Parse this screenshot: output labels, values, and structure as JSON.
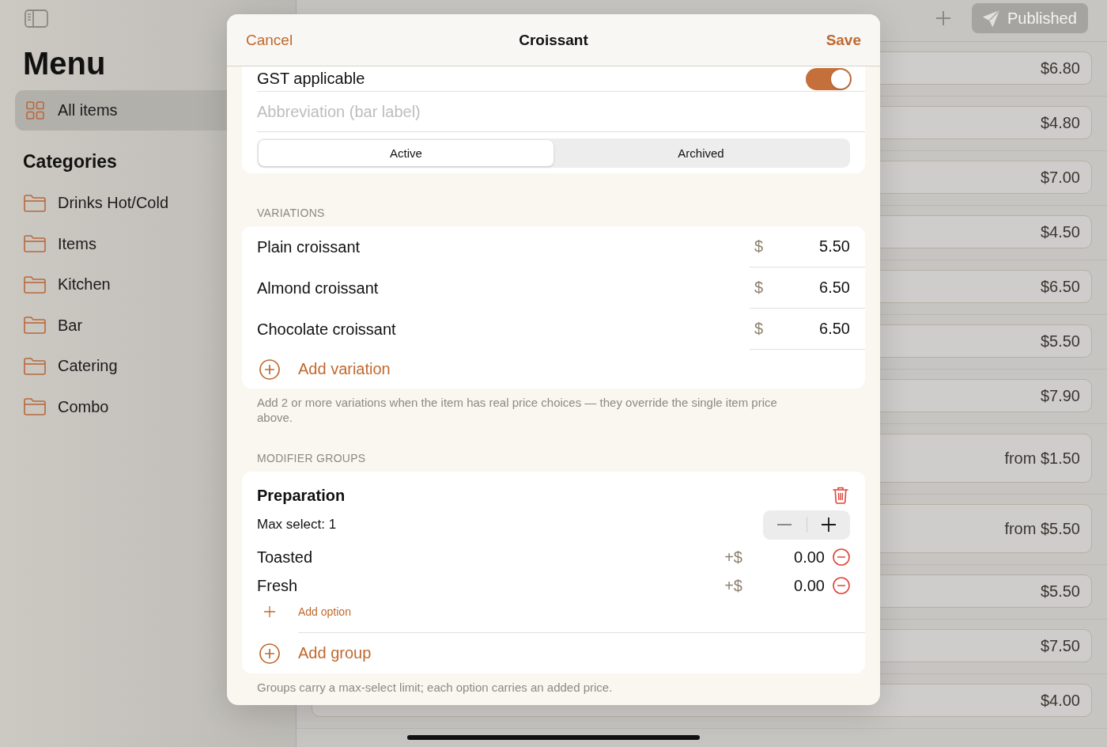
{
  "sidebar": {
    "title": "Menu",
    "items": [
      {
        "label": "All items",
        "selected": true
      }
    ],
    "categories_title": "Categories",
    "categories": [
      {
        "label": "Drinks Hot/Cold",
        "selected": false
      },
      {
        "label": "Items",
        "selected": false
      },
      {
        "label": "Kitchen",
        "selected": false
      },
      {
        "label": "Bar",
        "selected": false
      },
      {
        "label": "Catering",
        "selected": false
      },
      {
        "label": "Combo",
        "selected": false
      }
    ]
  },
  "toolbar": {
    "publish_button": "Published"
  },
  "item_list": {
    "rows": [
      {
        "price": "$6.80",
        "kind": "fixed"
      },
      {
        "price": "$4.80",
        "kind": "fixed"
      },
      {
        "price": "$7.00",
        "kind": "fixed"
      },
      {
        "price": "$4.50",
        "kind": "fixed"
      },
      {
        "price": "$6.50",
        "kind": "fixed"
      },
      {
        "price": "$5.50",
        "kind": "fixed"
      },
      {
        "price": "$7.90",
        "kind": "fixed"
      },
      {
        "price": "from $1.50",
        "kind": "range"
      },
      {
        "price": "from $5.50",
        "kind": "range"
      },
      {
        "price": "$5.50",
        "kind": "fixed"
      },
      {
        "price": "$7.50",
        "kind": "fixed"
      },
      {
        "price": "$4.00",
        "kind": "fixed"
      }
    ]
  },
  "dialog": {
    "cancel": "Cancel",
    "title": "Croissant",
    "save": "Save",
    "gst": {
      "label": "GST applicable",
      "on": true
    },
    "abbreviation": {
      "placeholder": "Abbreviation (bar label)"
    },
    "status_tabs": [
      {
        "label": "Active",
        "selected": true
      },
      {
        "label": "Archived",
        "selected": false
      }
    ],
    "variations": {
      "heading": "VARIATIONS",
      "rows": [
        {
          "name": "Plain croissant",
          "currency": "$",
          "price": "5.50"
        },
        {
          "name": "Almond croissant",
          "currency": "$",
          "price": "6.50"
        },
        {
          "name": "Chocolate croissant",
          "currency": "$",
          "price": "6.50"
        }
      ],
      "add_label": "Add variation",
      "note": "Add 2 or more variations when the item has real price choices — they override the single item price above."
    },
    "modifier_groups": {
      "heading": "MODIFIER GROUPS",
      "groups": [
        {
          "name": "Preparation",
          "max_select": "Max select: 1",
          "options": [
            {
              "name": "Toasted",
              "prefix": "+$",
              "price": "0.00"
            },
            {
              "name": "Fresh",
              "prefix": "+$",
              "price": "0.00"
            }
          ],
          "add_option": "Add option"
        }
      ],
      "add_group": "Add group",
      "note": "Groups carry a max-select limit; each option carries an added price."
    }
  }
}
